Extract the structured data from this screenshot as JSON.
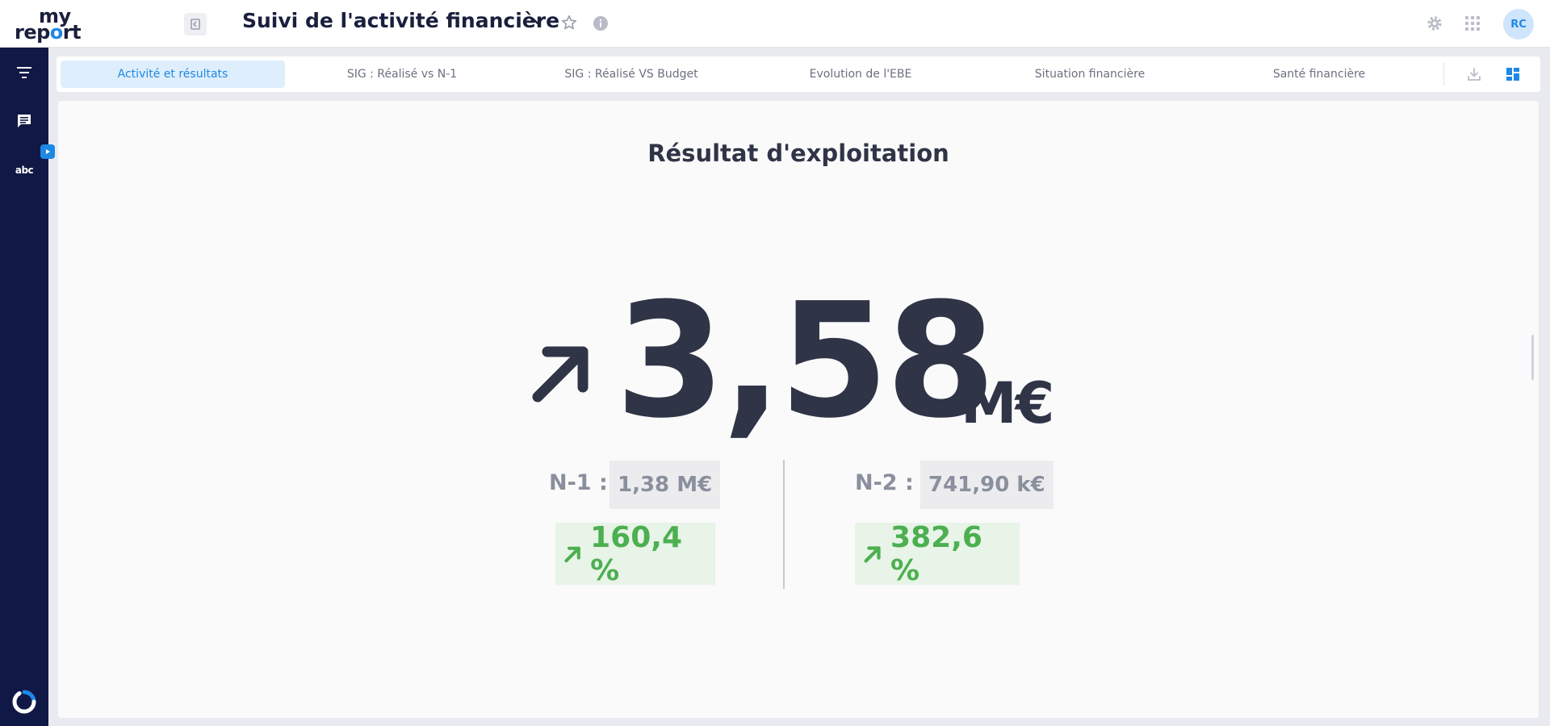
{
  "header": {
    "logo_line1": "my",
    "logo_line2_a": "rep",
    "logo_line2_b": "o",
    "logo_line2_c": "rt",
    "title": "Suivi de l'activité financière",
    "avatar_initials": "RC"
  },
  "rail": {
    "abc_label": "abc"
  },
  "tabs": [
    {
      "label": "Activité et résultats",
      "active": true
    },
    {
      "label": "SIG : Réalisé vs N-1",
      "active": false
    },
    {
      "label": "SIG : Réalisé VS Budget",
      "active": false
    },
    {
      "label": "Evolution de l'EBE",
      "active": false
    },
    {
      "label": "Situation financière",
      "active": false
    },
    {
      "label": "Santé financière",
      "active": false
    }
  ],
  "kpi": {
    "title": "Résultat d'exploitation",
    "value": "3,58",
    "unit": "M€",
    "trend": "up",
    "comparisons": [
      {
        "label": "N-1 :",
        "value": "1,38 M€",
        "growth": "160,4 %",
        "trend": "up"
      },
      {
        "label": "N-2 :",
        "value": "741,90 k€",
        "growth": "382,6 %",
        "trend": "up"
      }
    ]
  },
  "colors": {
    "accent": "#1e88e5",
    "rail": "#101846",
    "kpi_text": "#2f3446",
    "positive": "#4caf50",
    "muted": "#8a8f9d"
  },
  "icons": {
    "filter": "filter-icon",
    "comment": "comment-icon",
    "settings": "settings-icon",
    "apps": "apps-grid-icon",
    "download": "download-icon",
    "dashboard": "dashboard-icon"
  }
}
